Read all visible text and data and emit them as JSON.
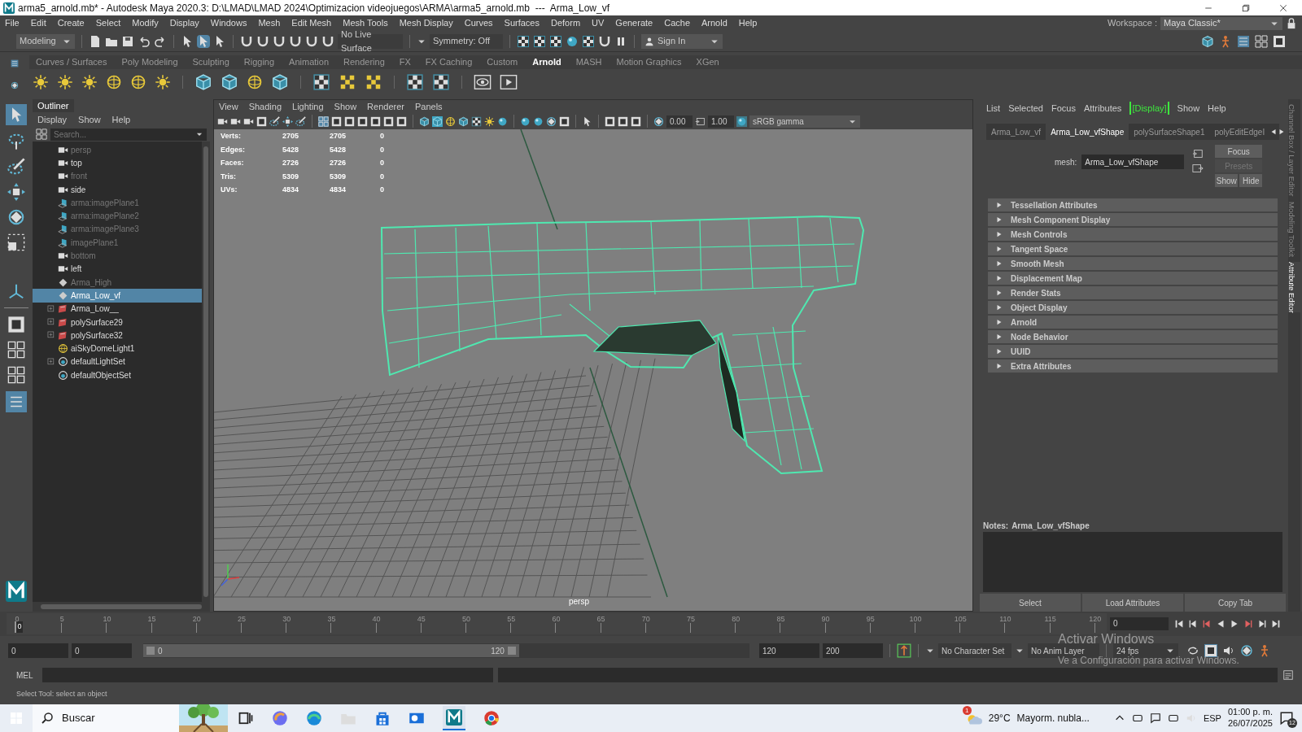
{
  "window": {
    "title": "arma5_arnold.mb* - Autodesk Maya 2020.3: D:\\LMAD\\LMAD 2024\\Optimizacion videojuegos\\ARMA\\arma5_arnold.mb  ---  Arma_Low_vf"
  },
  "menu_bar": [
    "File",
    "Edit",
    "Create",
    "Select",
    "Modify",
    "Display",
    "Windows",
    "Mesh",
    "Edit Mesh",
    "Mesh Tools",
    "Mesh Display",
    "Curves",
    "Surfaces",
    "Deform",
    "UV",
    "Generate",
    "Cache",
    "Arnold",
    "Help"
  ],
  "workspace": {
    "label": "Workspace :",
    "value": "Maya Classic*"
  },
  "status_line": {
    "menu_set": "Modeling",
    "live_surface": "No Live Surface",
    "symmetry": "Symmetry: Off",
    "sign_in": "Sign In"
  },
  "shelf_tabs": [
    {
      "label": "Curves / Surfaces",
      "selected": false
    },
    {
      "label": "Poly Modeling",
      "selected": false
    },
    {
      "label": "Sculpting",
      "selected": false
    },
    {
      "label": "Rigging",
      "selected": false
    },
    {
      "label": "Animation",
      "selected": false
    },
    {
      "label": "Rendering",
      "selected": false
    },
    {
      "label": "FX",
      "selected": false
    },
    {
      "label": "FX Caching",
      "selected": false
    },
    {
      "label": "Custom",
      "selected": false
    },
    {
      "label": "Arnold",
      "selected": true
    },
    {
      "label": "MASH",
      "selected": false
    },
    {
      "label": "Motion Graphics",
      "selected": false
    },
    {
      "label": "XGen",
      "selected": false
    }
  ],
  "outliner": {
    "title": "Outliner",
    "menu": [
      "Display",
      "Show",
      "Help"
    ],
    "search_placeholder": "Search...",
    "items": [
      {
        "label": "persp",
        "kind": "camera",
        "dimmed": true,
        "selected": false,
        "expandable": false
      },
      {
        "label": "top",
        "kind": "camera",
        "dimmed": false,
        "selected": false,
        "expandable": false
      },
      {
        "label": "front",
        "kind": "camera",
        "dimmed": true,
        "selected": false,
        "expandable": false
      },
      {
        "label": "side",
        "kind": "camera",
        "dimmed": false,
        "selected": false,
        "expandable": false
      },
      {
        "label": "arma:imagePlane1",
        "kind": "image_plane",
        "dimmed": true,
        "selected": false,
        "expandable": false
      },
      {
        "label": "arma:imagePlane2",
        "kind": "image_plane",
        "dimmed": true,
        "selected": false,
        "expandable": false
      },
      {
        "label": "arma:imagePlane3",
        "kind": "image_plane",
        "dimmed": true,
        "selected": false,
        "expandable": false
      },
      {
        "label": "imagePlane1",
        "kind": "image_plane",
        "dimmed": true,
        "selected": false,
        "expandable": false
      },
      {
        "label": "bottom",
        "kind": "camera",
        "dimmed": true,
        "selected": false,
        "expandable": false
      },
      {
        "label": "left",
        "kind": "camera",
        "dimmed": false,
        "selected": false,
        "expandable": false
      },
      {
        "label": "Arma_High",
        "kind": "transform",
        "dimmed": true,
        "selected": false,
        "expandable": false
      },
      {
        "label": "Arma_Low_vf",
        "kind": "transform",
        "dimmed": false,
        "selected": true,
        "expandable": false
      },
      {
        "label": "Arma_Low__",
        "kind": "mesh",
        "dimmed": false,
        "selected": false,
        "expandable": true
      },
      {
        "label": "polySurface29",
        "kind": "mesh",
        "dimmed": false,
        "selected": false,
        "expandable": true
      },
      {
        "label": "polySurface32",
        "kind": "mesh",
        "dimmed": false,
        "selected": false,
        "expandable": true
      },
      {
        "label": "aiSkyDomeLight1",
        "kind": "light",
        "dimmed": false,
        "selected": false,
        "expandable": false
      },
      {
        "label": "defaultLightSet",
        "kind": "set",
        "dimmed": false,
        "selected": false,
        "expandable": true
      },
      {
        "label": "defaultObjectSet",
        "kind": "set",
        "dimmed": false,
        "selected": false,
        "expandable": false
      }
    ]
  },
  "viewport": {
    "menu": [
      "View",
      "Shading",
      "Lighting",
      "Show",
      "Renderer",
      "Panels"
    ],
    "exposure": "0.00",
    "gamma": "1.00",
    "color_space": "sRGB gamma",
    "camera": "persp",
    "hud": [
      {
        "label": "Verts:",
        "values": [
          "2705",
          "2705",
          "0"
        ]
      },
      {
        "label": "Edges:",
        "values": [
          "5428",
          "5428",
          "0"
        ]
      },
      {
        "label": "Faces:",
        "values": [
          "2726",
          "2726",
          "0"
        ]
      },
      {
        "label": "Tris:",
        "values": [
          "5309",
          "5309",
          "0"
        ]
      },
      {
        "label": "UVs:",
        "values": [
          "4834",
          "4834",
          "0"
        ]
      }
    ]
  },
  "attribute_editor": {
    "menu": [
      {
        "label": "List",
        "highlighted": false
      },
      {
        "label": "Selected",
        "highlighted": false
      },
      {
        "label": "Focus",
        "highlighted": false
      },
      {
        "label": "Attributes",
        "highlighted": false
      },
      {
        "label": "[Display]",
        "highlighted": true
      },
      {
        "label": "Show",
        "highlighted": false
      },
      {
        "label": "Help",
        "highlighted": false
      }
    ],
    "tabs": [
      {
        "label": "Arma_Low_vf",
        "selected": false
      },
      {
        "label": "Arma_Low_vfShape",
        "selected": true
      },
      {
        "label": "polySurfaceShape1",
        "selected": false
      },
      {
        "label": "polyEditEdgeI",
        "selected": false
      }
    ],
    "mesh_label": "mesh:",
    "mesh_value": "Arma_Low_vfShape",
    "focus": "Focus",
    "presets": "Presets",
    "show": "Show",
    "hide": "Hide",
    "sections": [
      "Tessellation Attributes",
      "Mesh Component Display",
      "Mesh Controls",
      "Tangent Space",
      "Smooth Mesh",
      "Displacement Map",
      "Render Stats",
      "Object Display",
      "Arnold",
      "Node Behavior",
      "UUID",
      "Extra Attributes"
    ],
    "notes_label": "Notes:",
    "notes_value": "Arma_Low_vfShape",
    "buttons": [
      "Select",
      "Load Attributes",
      "Copy Tab"
    ]
  },
  "side_tabs": [
    {
      "label": "Channel Box / Layer Editor",
      "selected": false
    },
    {
      "label": "Modeling Toolkit",
      "selected": false
    },
    {
      "label": "Attribute Editor",
      "selected": true
    }
  ],
  "time_slider": {
    "ticks": [
      "0",
      "5",
      "10",
      "15",
      "20",
      "25",
      "30",
      "35",
      "40",
      "45",
      "50",
      "55",
      "60",
      "65",
      "70",
      "75",
      "80",
      "85",
      "90",
      "95",
      "100",
      "105",
      "110",
      "115",
      "120"
    ],
    "current": "0",
    "current_field": "0",
    "level": 0
  },
  "range_slider": {
    "start": "0",
    "inner_start": "0",
    "range_start": "0",
    "range_end": "120",
    "inner_end": "120",
    "end": "200",
    "level": 0.62,
    "character_set": "No Character Set",
    "anim_layer": "No Anim Layer",
    "fps": "24 fps"
  },
  "command_line": {
    "label": "MEL"
  },
  "help_line": "Select Tool: select an object",
  "activation_notice": {
    "title": "Activar Windows",
    "subtitle": "Ve a Configuración para activar Windows."
  },
  "taskbar": {
    "search": "Buscar",
    "weather": "29°C",
    "forecast": "Mayorm. nubla...",
    "alert_count": "1",
    "language": "ESP",
    "time": "01:00 p. m.",
    "date": "26/07/2025",
    "notifications": "12"
  }
}
